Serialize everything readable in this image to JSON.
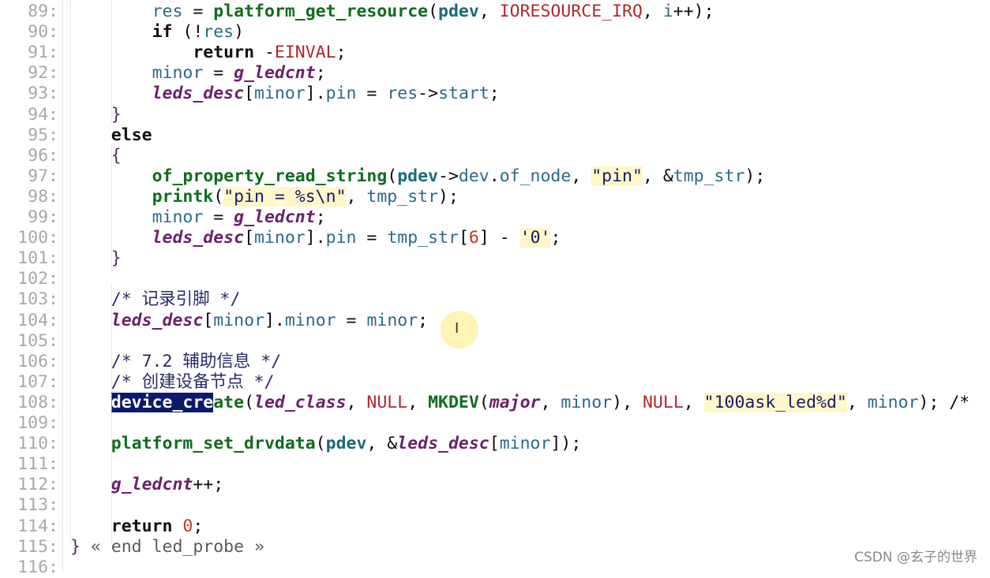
{
  "editor": {
    "lines": [
      {
        "n": "89:",
        "segs": [
          [
            "        ",
            ""
          ],
          [
            "res",
            "t-var"
          ],
          [
            " = ",
            ""
          ],
          [
            "platform_get_resource",
            "t-fn"
          ],
          [
            "(",
            ""
          ],
          [
            "pdev",
            "t-pdev"
          ],
          [
            ", ",
            ""
          ],
          [
            "IORESOURCE_IRQ",
            "t-mac"
          ],
          [
            ", ",
            ""
          ],
          [
            "i",
            "t-var"
          ],
          [
            "++);",
            ""
          ]
        ]
      },
      {
        "n": "90:",
        "segs": [
          [
            "        ",
            ""
          ],
          [
            "if",
            "t-kw"
          ],
          [
            " (!",
            ""
          ],
          [
            "res",
            "t-var"
          ],
          [
            ")",
            ""
          ]
        ]
      },
      {
        "n": "91:",
        "segs": [
          [
            "            ",
            ""
          ],
          [
            "return",
            "t-kw"
          ],
          [
            " -",
            ""
          ],
          [
            "EINVAL",
            "t-mac"
          ],
          [
            ";",
            ""
          ]
        ]
      },
      {
        "n": "92:",
        "segs": [
          [
            "        ",
            ""
          ],
          [
            "minor",
            "t-var"
          ],
          [
            " = ",
            ""
          ],
          [
            "g_ledcnt",
            "t-glob"
          ],
          [
            ";",
            ""
          ]
        ]
      },
      {
        "n": "93:",
        "segs": [
          [
            "        ",
            ""
          ],
          [
            "leds_desc",
            "t-glob"
          ],
          [
            "[",
            ""
          ],
          [
            "minor",
            "t-var"
          ],
          [
            "].",
            ""
          ],
          [
            "pin",
            "t-field"
          ],
          [
            " = ",
            ""
          ],
          [
            "res",
            "t-var"
          ],
          [
            "->",
            ""
          ],
          [
            "start",
            "t-field"
          ],
          [
            ";",
            ""
          ]
        ]
      },
      {
        "n": "94:",
        "segs": [
          [
            "    ",
            ""
          ],
          [
            "}",
            "t-brace"
          ]
        ]
      },
      {
        "n": "95:",
        "segs": [
          [
            "    ",
            ""
          ],
          [
            "else",
            "t-kw"
          ]
        ]
      },
      {
        "n": "96:",
        "segs": [
          [
            "    ",
            ""
          ],
          [
            "{",
            "t-brace"
          ]
        ]
      },
      {
        "n": "97:",
        "segs": [
          [
            "        ",
            ""
          ],
          [
            "of_property_read_string",
            "t-fn"
          ],
          [
            "(",
            ""
          ],
          [
            "pdev",
            "t-pdev"
          ],
          [
            "->",
            ""
          ],
          [
            "dev",
            "t-field"
          ],
          [
            ".",
            ""
          ],
          [
            "of_node",
            "t-field"
          ],
          [
            ", ",
            ""
          ],
          [
            "\"pin\"",
            "t-str"
          ],
          [
            ", &",
            ""
          ],
          [
            "tmp_str",
            "t-var"
          ],
          [
            ");",
            ""
          ]
        ]
      },
      {
        "n": "98:",
        "segs": [
          [
            "        ",
            ""
          ],
          [
            "printk",
            "t-fn"
          ],
          [
            "(",
            ""
          ],
          [
            "\"pin = %s\\n\"",
            "t-str"
          ],
          [
            ", ",
            ""
          ],
          [
            "tmp_str",
            "t-var"
          ],
          [
            ");",
            ""
          ]
        ]
      },
      {
        "n": "99:",
        "segs": [
          [
            "        ",
            ""
          ],
          [
            "minor",
            "t-var"
          ],
          [
            " = ",
            ""
          ],
          [
            "g_ledcnt",
            "t-glob"
          ],
          [
            ";",
            ""
          ]
        ]
      },
      {
        "n": "100:",
        "segs": [
          [
            "        ",
            ""
          ],
          [
            "leds_desc",
            "t-glob"
          ],
          [
            "[",
            ""
          ],
          [
            "minor",
            "t-var"
          ],
          [
            "].",
            ""
          ],
          [
            "pin",
            "t-field"
          ],
          [
            " = ",
            ""
          ],
          [
            "tmp_str",
            "t-var"
          ],
          [
            "[",
            ""
          ],
          [
            "6",
            "t-num"
          ],
          [
            "] - ",
            ""
          ],
          [
            "'0'",
            "t-str"
          ],
          [
            ";",
            ""
          ]
        ]
      },
      {
        "n": "101:",
        "segs": [
          [
            "    ",
            ""
          ],
          [
            "}",
            "t-brace"
          ]
        ]
      },
      {
        "n": "102:",
        "segs": []
      },
      {
        "n": "103:",
        "segs": [
          [
            "    ",
            ""
          ],
          [
            "/* 记录引脚 */",
            "t-cmt"
          ]
        ]
      },
      {
        "n": "104:",
        "segs": [
          [
            "    ",
            ""
          ],
          [
            "leds_desc",
            "t-glob"
          ],
          [
            "[",
            ""
          ],
          [
            "minor",
            "t-var"
          ],
          [
            "].",
            ""
          ],
          [
            "minor",
            "t-field"
          ],
          [
            " = ",
            ""
          ],
          [
            "minor",
            "t-var"
          ],
          [
            ";",
            ""
          ]
        ]
      },
      {
        "n": "105:",
        "segs": []
      },
      {
        "n": "106:",
        "segs": [
          [
            "    ",
            ""
          ],
          [
            "/* 7.2 辅助信息 */",
            "t-cmt"
          ]
        ]
      },
      {
        "n": "107:",
        "segs": [
          [
            "    ",
            ""
          ],
          [
            "/* 创建设备节点 */",
            "t-cmt"
          ]
        ]
      },
      {
        "n": "108:",
        "segs": [
          [
            "    ",
            ""
          ],
          [
            "device_cre",
            "t-sel"
          ],
          [
            "ate",
            "t-fn"
          ],
          [
            "(",
            ""
          ],
          [
            "led_class",
            "t-glob"
          ],
          [
            ", ",
            ""
          ],
          [
            "NULL",
            "t-mac"
          ],
          [
            ", ",
            ""
          ],
          [
            "MKDEV",
            "t-mac-b"
          ],
          [
            "(",
            ""
          ],
          [
            "major",
            "t-glob"
          ],
          [
            ", ",
            ""
          ],
          [
            "minor",
            "t-var"
          ],
          [
            "), ",
            ""
          ],
          [
            "NULL",
            "t-mac"
          ],
          [
            ", ",
            ""
          ],
          [
            "\"100ask_led%d\"",
            "t-str"
          ],
          [
            ", ",
            ""
          ],
          [
            "minor",
            "t-var"
          ],
          [
            "); /*",
            ""
          ]
        ]
      },
      {
        "n": "109:",
        "segs": []
      },
      {
        "n": "110:",
        "segs": [
          [
            "    ",
            ""
          ],
          [
            "platform_set_drvdata",
            "t-fn"
          ],
          [
            "(",
            ""
          ],
          [
            "pdev",
            "t-pdev"
          ],
          [
            ", &",
            ""
          ],
          [
            "leds_desc",
            "t-glob"
          ],
          [
            "[",
            ""
          ],
          [
            "minor",
            "t-var"
          ],
          [
            "]);",
            ""
          ]
        ]
      },
      {
        "n": "111:",
        "segs": []
      },
      {
        "n": "112:",
        "segs": [
          [
            "    ",
            ""
          ],
          [
            "g_ledcnt",
            "t-glob"
          ],
          [
            "++;",
            ""
          ]
        ]
      },
      {
        "n": "113:",
        "segs": []
      },
      {
        "n": "114:",
        "segs": [
          [
            "    ",
            ""
          ],
          [
            "return",
            "t-kw"
          ],
          [
            " ",
            ""
          ],
          [
            "0",
            "t-num"
          ],
          [
            ";",
            ""
          ]
        ]
      },
      {
        "n": "115:",
        "segs": [
          [
            "",
            ""
          ],
          [
            "}",
            "t-brace"
          ],
          [
            " « end led_probe »",
            "t-fold"
          ]
        ]
      },
      {
        "n": "116:",
        "segs": []
      }
    ]
  },
  "watermark": "CSDN @玄子的世界"
}
